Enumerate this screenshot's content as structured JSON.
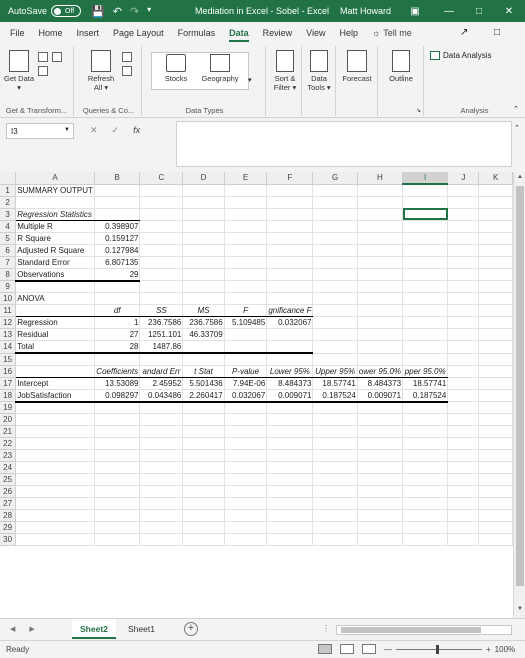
{
  "titlebar": {
    "autosave_label": "AutoSave",
    "autosave_state": "Off",
    "title": "Mediation in Excel - Sobel  -  Excel",
    "user": "Matt Howard"
  },
  "tabs": [
    "File",
    "Home",
    "Insert",
    "Page Layout",
    "Formulas",
    "Data",
    "Review",
    "View",
    "Help"
  ],
  "active_tab": "Data",
  "tell_me": "Tell me",
  "ribbon": {
    "get_data": "Get Data ▾",
    "refresh_all": "Refresh All ▾",
    "stocks": "Stocks",
    "geography": "Geography",
    "sort_filter": "Sort & Filter ▾",
    "data_tools": "Data Tools ▾",
    "forecast": "Forecast",
    "outline": "Outline",
    "data_analysis": "Data Analysis",
    "groups": {
      "get_transform": "Get & Transform...",
      "queries": "Queries & Co...",
      "data_types": "Data Types",
      "analysis": "Analysis"
    }
  },
  "formula_bar": {
    "name_box": "I3",
    "formula": ""
  },
  "columns": [
    "A",
    "B",
    "C",
    "D",
    "E",
    "F",
    "G",
    "H",
    "I",
    "J",
    "K"
  ],
  "selected_column": "I",
  "rows": [
    [
      "SUMMARY OUTPUT",
      "",
      "",
      "",
      "",
      "",
      "",
      "",
      "",
      "",
      ""
    ],
    [
      "",
      "",
      "",
      "",
      "",
      "",
      "",
      "",
      "",
      "",
      ""
    ],
    [
      "Regression Statistics",
      "",
      "",
      "",
      "",
      "",
      "",
      "",
      "",
      "",
      ""
    ],
    [
      "Multiple R",
      "0.398907",
      "",
      "",
      "",
      "",
      "",
      "",
      "",
      "",
      ""
    ],
    [
      "R Square",
      "0.159127",
      "",
      "",
      "",
      "",
      "",
      "",
      "",
      "",
      ""
    ],
    [
      "Adjusted R Square",
      "0.127984",
      "",
      "",
      "",
      "",
      "",
      "",
      "",
      "",
      ""
    ],
    [
      "Standard Error",
      "6.807135",
      "",
      "",
      "",
      "",
      "",
      "",
      "",
      "",
      ""
    ],
    [
      "Observations",
      "29",
      "",
      "",
      "",
      "",
      "",
      "",
      "",
      "",
      ""
    ],
    [
      "",
      "",
      "",
      "",
      "",
      "",
      "",
      "",
      "",
      "",
      ""
    ],
    [
      "ANOVA",
      "",
      "",
      "",
      "",
      "",
      "",
      "",
      "",
      "",
      ""
    ],
    [
      "",
      "df",
      "SS",
      "MS",
      "F",
      "gnificance F",
      "",
      "",
      "",
      "",
      ""
    ],
    [
      "Regression",
      "1",
      "236.7586",
      "236.7586",
      "5.109485",
      "0.032067",
      "",
      "",
      "",
      "",
      ""
    ],
    [
      "Residual",
      "27",
      "1251.101",
      "46.33709",
      "",
      "",
      "",
      "",
      "",
      "",
      ""
    ],
    [
      "Total",
      "28",
      "1487.86",
      "",
      "",
      "",
      "",
      "",
      "",
      "",
      ""
    ],
    [
      "",
      "",
      "",
      "",
      "",
      "",
      "",
      "",
      "",
      "",
      ""
    ],
    [
      "",
      "Coefficients",
      "andard Err",
      "t Stat",
      "P-value",
      "Lower 95%",
      "Upper 95%",
      "ower 95.0%",
      "pper 95.0%",
      "",
      ""
    ],
    [
      "Intercept",
      "13.53089",
      "2.45952",
      "5.501436",
      "7.94E-06",
      "8.484373",
      "18.57741",
      "8.484373",
      "18.57741",
      "",
      ""
    ],
    [
      "JobSatisfaction",
      "0.098297",
      "0.043486",
      "2.260417",
      "0.032067",
      "0.009071",
      "0.187524",
      "0.009071",
      "0.187524",
      "",
      ""
    ]
  ],
  "total_rows": 30,
  "sheets": [
    "Sheet2",
    "Sheet1"
  ],
  "active_sheet": "Sheet2",
  "status": {
    "ready": "Ready",
    "zoom": "100%"
  }
}
